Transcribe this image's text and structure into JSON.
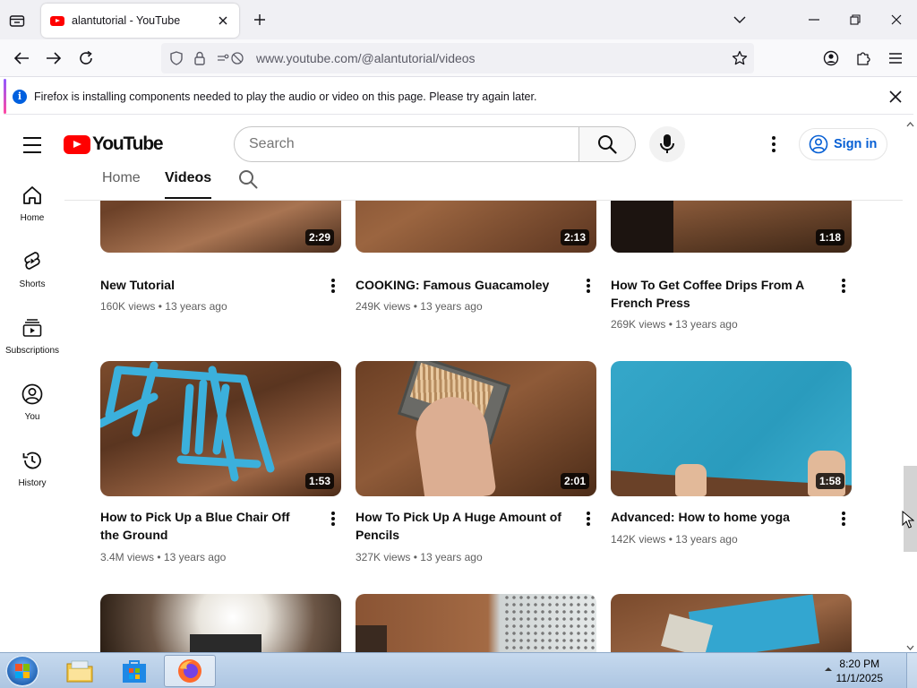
{
  "browser": {
    "tab_title": "alantutorial - YouTube",
    "url_host": "www.youtube.com",
    "url_path": "/@alantutorial/videos"
  },
  "notification": {
    "text": "Firefox is installing components needed to play the audio or video on this page. Please try again later."
  },
  "youtube": {
    "logo_text": "YouTube",
    "search_placeholder": "Search",
    "sign_in_label": "Sign in",
    "channel_tabs": [
      "Home",
      "Videos"
    ],
    "sidebar": [
      "Home",
      "Shorts",
      "Subscriptions",
      "You",
      "History"
    ],
    "videos": [
      {
        "title": "New Tutorial",
        "views": "160K views",
        "age": "13 years ago",
        "duration": "2:29"
      },
      {
        "title": "COOKING: Famous Guacamoley",
        "views": "249K views",
        "age": "13 years ago",
        "duration": "2:13"
      },
      {
        "title": "How To Get Coffee Drips From A French Press",
        "views": "269K views",
        "age": "13 years ago",
        "duration": "1:18"
      },
      {
        "title": "How to Pick Up a Blue Chair Off the Ground",
        "views": "3.4M views",
        "age": "13 years ago",
        "duration": "1:53"
      },
      {
        "title": "How To Pick Up A Huge Amount of Pencils",
        "views": "327K views",
        "age": "13 years ago",
        "duration": "2:01"
      },
      {
        "title": "Advanced: How to home yoga",
        "views": "142K views",
        "age": "13 years ago",
        "duration": "1:58"
      },
      {
        "title": "",
        "views": "",
        "age": "",
        "duration": ""
      },
      {
        "title": "",
        "views": "",
        "age": "",
        "duration": ""
      },
      {
        "title": "",
        "views": "",
        "age": "",
        "duration": ""
      }
    ],
    "meta_separator": "•"
  },
  "taskbar": {
    "time": "8:20 PM",
    "date": "11/1/2025"
  },
  "colors": {
    "youtube_red": "#ff0000",
    "link_blue": "#065fd4",
    "firefox_info": "#0060df"
  }
}
